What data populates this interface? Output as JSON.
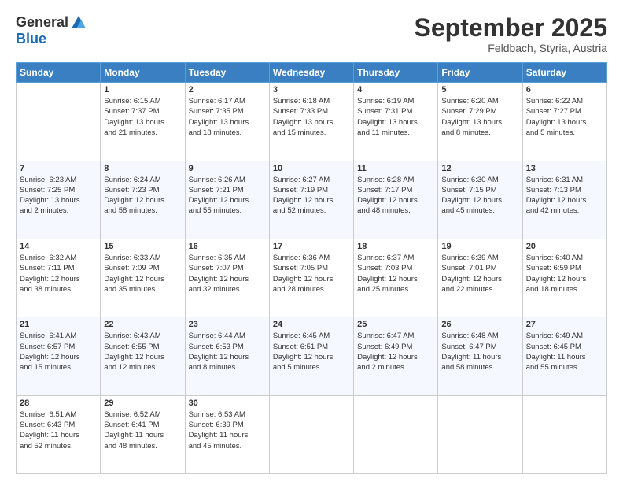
{
  "header": {
    "logo_general": "General",
    "logo_blue": "Blue",
    "month": "September 2025",
    "location": "Feldbach, Styria, Austria"
  },
  "days_of_week": [
    "Sunday",
    "Monday",
    "Tuesday",
    "Wednesday",
    "Thursday",
    "Friday",
    "Saturday"
  ],
  "weeks": [
    [
      {
        "day": "",
        "lines": []
      },
      {
        "day": "1",
        "lines": [
          "Sunrise: 6:15 AM",
          "Sunset: 7:37 PM",
          "Daylight: 13 hours",
          "and 21 minutes."
        ]
      },
      {
        "day": "2",
        "lines": [
          "Sunrise: 6:17 AM",
          "Sunset: 7:35 PM",
          "Daylight: 13 hours",
          "and 18 minutes."
        ]
      },
      {
        "day": "3",
        "lines": [
          "Sunrise: 6:18 AM",
          "Sunset: 7:33 PM",
          "Daylight: 13 hours",
          "and 15 minutes."
        ]
      },
      {
        "day": "4",
        "lines": [
          "Sunrise: 6:19 AM",
          "Sunset: 7:31 PM",
          "Daylight: 13 hours",
          "and 11 minutes."
        ]
      },
      {
        "day": "5",
        "lines": [
          "Sunrise: 6:20 AM",
          "Sunset: 7:29 PM",
          "Daylight: 13 hours",
          "and 8 minutes."
        ]
      },
      {
        "day": "6",
        "lines": [
          "Sunrise: 6:22 AM",
          "Sunset: 7:27 PM",
          "Daylight: 13 hours",
          "and 5 minutes."
        ]
      }
    ],
    [
      {
        "day": "7",
        "lines": [
          "Sunrise: 6:23 AM",
          "Sunset: 7:25 PM",
          "Daylight: 13 hours",
          "and 2 minutes."
        ]
      },
      {
        "day": "8",
        "lines": [
          "Sunrise: 6:24 AM",
          "Sunset: 7:23 PM",
          "Daylight: 12 hours",
          "and 58 minutes."
        ]
      },
      {
        "day": "9",
        "lines": [
          "Sunrise: 6:26 AM",
          "Sunset: 7:21 PM",
          "Daylight: 12 hours",
          "and 55 minutes."
        ]
      },
      {
        "day": "10",
        "lines": [
          "Sunrise: 6:27 AM",
          "Sunset: 7:19 PM",
          "Daylight: 12 hours",
          "and 52 minutes."
        ]
      },
      {
        "day": "11",
        "lines": [
          "Sunrise: 6:28 AM",
          "Sunset: 7:17 PM",
          "Daylight: 12 hours",
          "and 48 minutes."
        ]
      },
      {
        "day": "12",
        "lines": [
          "Sunrise: 6:30 AM",
          "Sunset: 7:15 PM",
          "Daylight: 12 hours",
          "and 45 minutes."
        ]
      },
      {
        "day": "13",
        "lines": [
          "Sunrise: 6:31 AM",
          "Sunset: 7:13 PM",
          "Daylight: 12 hours",
          "and 42 minutes."
        ]
      }
    ],
    [
      {
        "day": "14",
        "lines": [
          "Sunrise: 6:32 AM",
          "Sunset: 7:11 PM",
          "Daylight: 12 hours",
          "and 38 minutes."
        ]
      },
      {
        "day": "15",
        "lines": [
          "Sunrise: 6:33 AM",
          "Sunset: 7:09 PM",
          "Daylight: 12 hours",
          "and 35 minutes."
        ]
      },
      {
        "day": "16",
        "lines": [
          "Sunrise: 6:35 AM",
          "Sunset: 7:07 PM",
          "Daylight: 12 hours",
          "and 32 minutes."
        ]
      },
      {
        "day": "17",
        "lines": [
          "Sunrise: 6:36 AM",
          "Sunset: 7:05 PM",
          "Daylight: 12 hours",
          "and 28 minutes."
        ]
      },
      {
        "day": "18",
        "lines": [
          "Sunrise: 6:37 AM",
          "Sunset: 7:03 PM",
          "Daylight: 12 hours",
          "and 25 minutes."
        ]
      },
      {
        "day": "19",
        "lines": [
          "Sunrise: 6:39 AM",
          "Sunset: 7:01 PM",
          "Daylight: 12 hours",
          "and 22 minutes."
        ]
      },
      {
        "day": "20",
        "lines": [
          "Sunrise: 6:40 AM",
          "Sunset: 6:59 PM",
          "Daylight: 12 hours",
          "and 18 minutes."
        ]
      }
    ],
    [
      {
        "day": "21",
        "lines": [
          "Sunrise: 6:41 AM",
          "Sunset: 6:57 PM",
          "Daylight: 12 hours",
          "and 15 minutes."
        ]
      },
      {
        "day": "22",
        "lines": [
          "Sunrise: 6:43 AM",
          "Sunset: 6:55 PM",
          "Daylight: 12 hours",
          "and 12 minutes."
        ]
      },
      {
        "day": "23",
        "lines": [
          "Sunrise: 6:44 AM",
          "Sunset: 6:53 PM",
          "Daylight: 12 hours",
          "and 8 minutes."
        ]
      },
      {
        "day": "24",
        "lines": [
          "Sunrise: 6:45 AM",
          "Sunset: 6:51 PM",
          "Daylight: 12 hours",
          "and 5 minutes."
        ]
      },
      {
        "day": "25",
        "lines": [
          "Sunrise: 6:47 AM",
          "Sunset: 6:49 PM",
          "Daylight: 12 hours",
          "and 2 minutes."
        ]
      },
      {
        "day": "26",
        "lines": [
          "Sunrise: 6:48 AM",
          "Sunset: 6:47 PM",
          "Daylight: 11 hours",
          "and 58 minutes."
        ]
      },
      {
        "day": "27",
        "lines": [
          "Sunrise: 6:49 AM",
          "Sunset: 6:45 PM",
          "Daylight: 11 hours",
          "and 55 minutes."
        ]
      }
    ],
    [
      {
        "day": "28",
        "lines": [
          "Sunrise: 6:51 AM",
          "Sunset: 6:43 PM",
          "Daylight: 11 hours",
          "and 52 minutes."
        ]
      },
      {
        "day": "29",
        "lines": [
          "Sunrise: 6:52 AM",
          "Sunset: 6:41 PM",
          "Daylight: 11 hours",
          "and 48 minutes."
        ]
      },
      {
        "day": "30",
        "lines": [
          "Sunrise: 6:53 AM",
          "Sunset: 6:39 PM",
          "Daylight: 11 hours",
          "and 45 minutes."
        ]
      },
      {
        "day": "",
        "lines": []
      },
      {
        "day": "",
        "lines": []
      },
      {
        "day": "",
        "lines": []
      },
      {
        "day": "",
        "lines": []
      }
    ]
  ]
}
